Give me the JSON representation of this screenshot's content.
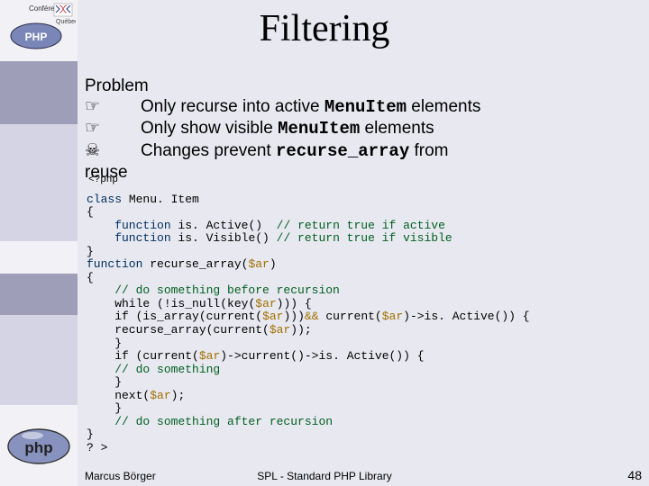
{
  "title": "Filtering",
  "problem_label": "Problem",
  "bullets": [
    {
      "sym": "☞",
      "pre": "Only recurse into active ",
      "mono": "MenuItem",
      "post": " elements"
    },
    {
      "sym": "☞",
      "pre": "Only show visible ",
      "mono": "MenuItem",
      "post": " elements"
    },
    {
      "sym": "☠",
      "pre": "Changes prevent ",
      "mono": "recurse_array",
      "post": " from"
    }
  ],
  "reuse": "reuse",
  "code_php_open": "<?php",
  "code_l1a": "class",
  "code_l1b": " Menu. Item",
  "code_l2": "{",
  "code_l3a": "    function",
  "code_l3b": " is. Active",
  "code_l3c": "()  ",
  "code_l3d": "// return true if active",
  "code_l4a": "    function",
  "code_l4b": " is. Visible",
  "code_l4c": "() ",
  "code_l4d": "// return true if visible",
  "code_l5": "}",
  "code_l6a": "function",
  "code_l6b": " recurse_array",
  "code_l6c": "(",
  "code_l6d": "$ar",
  "code_l6e": ")",
  "code_l7": "{",
  "code_l8": "    // do something before recursion",
  "code_l9a": "    while (!",
  "code_l9b": "is_null",
  "code_l9c": "(",
  "code_l9d": "key",
  "code_l9e": "(",
  "code_l9f": "$ar",
  "code_l9g": "))) {",
  "code_l10a": "    if (",
  "code_l10b": "is_array",
  "code_l10c": "(",
  "code_l10d": "current",
  "code_l10e": "(",
  "code_l10f": "$ar",
  "code_l10g": ")))",
  "code_l10h": "&&",
  "code_l10i": " ",
  "code_l10j": "current",
  "code_l10k": "(",
  "code_l10l": "$ar",
  "code_l10m": ")->",
  "code_l10n": "is. Active",
  "code_l10o": "()) {",
  "code_l11a": "    recurse_array",
  "code_l11b": "(",
  "code_l11c": "current",
  "code_l11d": "(",
  "code_l11e": "$ar",
  "code_l11f": "));",
  "code_l12": "    }",
  "code_l13a": "    if (",
  "code_l13b": "current",
  "code_l13c": "(",
  "code_l13d": "$ar",
  "code_l13e": ")->",
  "code_l13f": "current",
  "code_l13g": "()->",
  "code_l13h": "is. Active",
  "code_l13i": "()) {",
  "code_l14": "    // do something",
  "code_l15": "    }",
  "code_l16a": "    next",
  "code_l16b": "(",
  "code_l16c": "$ar",
  "code_l16d": ");",
  "code_l17": "    }",
  "code_l18": "    // do something after recursion",
  "code_l19": "}",
  "code_l20": "? >",
  "footer": {
    "author": "Marcus Börger",
    "center": "SPL - Standard PHP Library",
    "page": "48"
  }
}
